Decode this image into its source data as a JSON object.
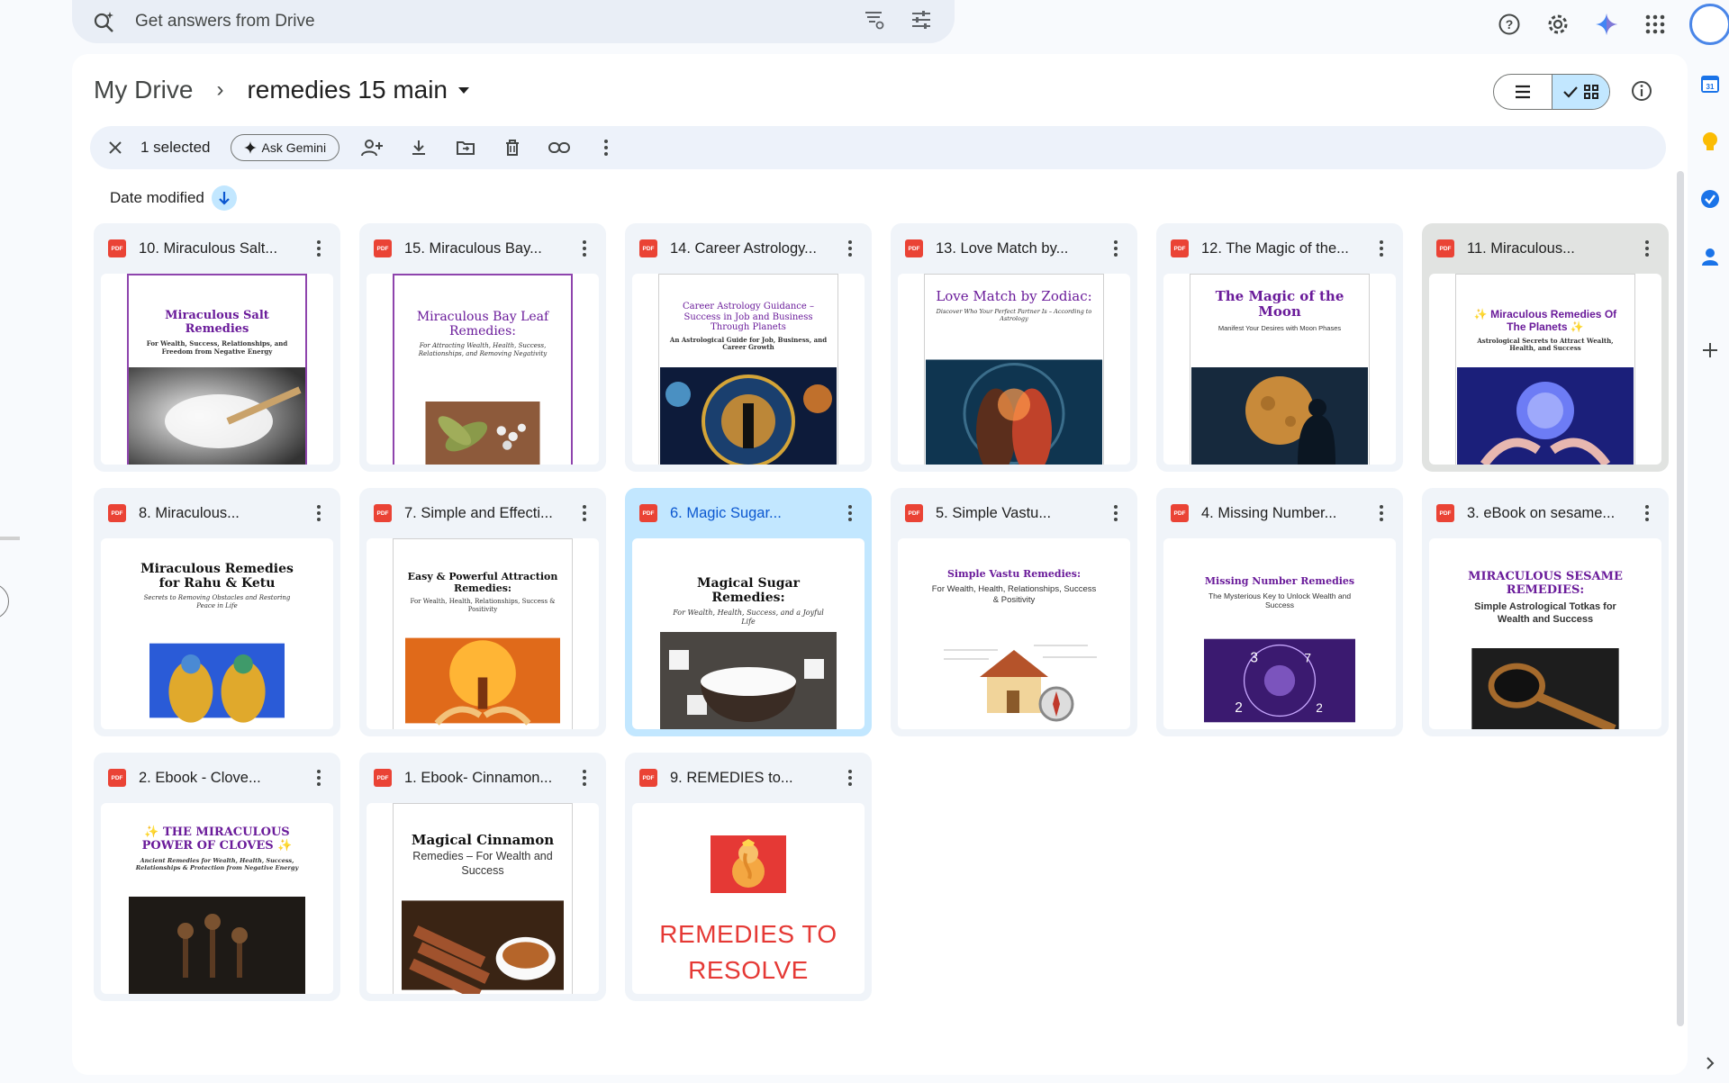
{
  "search": {
    "placeholder": "Get answers from Drive"
  },
  "breadcrumb": {
    "root": "My Drive",
    "current": "remedies 15 main"
  },
  "selection": {
    "count_label": "1 selected",
    "ask_gemini": "Ask Gemini"
  },
  "sort": {
    "label": "Date modified"
  },
  "files": [
    {
      "name": "10. Miraculous Salt...",
      "type": "PDF",
      "cover_title": "Miraculous Salt Remedies",
      "cover_sub": "For Wealth, Success, Relationships, and Freedom from Negative Energy"
    },
    {
      "name": "15. Miraculous Bay...",
      "type": "PDF",
      "cover_title": "Miraculous Bay Leaf Remedies:",
      "cover_sub": "For Attracting Wealth, Health, Success, Relationships, and Removing Negativity"
    },
    {
      "name": "14. Career Astrology...",
      "type": "PDF",
      "cover_title": "Career Astrology Guidance – Success in Job and Business Through Planets",
      "cover_sub": "An Astrological Guide for Job, Business, and Career Growth"
    },
    {
      "name": "13. Love Match by...",
      "type": "PDF",
      "cover_title": "Love Match by Zodiac:",
      "cover_sub": "Discover Who Your Perfect Partner Is – According to Astrology"
    },
    {
      "name": "12. The Magic of the...",
      "type": "PDF",
      "cover_title": "The Magic of the Moon",
      "cover_sub": "Manifest Your Desires with Moon Phases"
    },
    {
      "name": "11. Miraculous...",
      "type": "PDF",
      "cover_title": "✨ Miraculous Remedies Of The Planets ✨",
      "cover_sub": "Astrological Secrets to Attract Wealth, Health, and Success"
    },
    {
      "name": "8. Miraculous...",
      "type": "PDF",
      "cover_title": "Miraculous Remedies for Rahu & Ketu",
      "cover_sub": "Secrets to Removing Obstacles and Restoring Peace in Life"
    },
    {
      "name": "7. Simple and Effecti...",
      "type": "PDF",
      "cover_title": "Easy & Powerful Attraction Remedies:",
      "cover_sub": "For Wealth, Health, Relationships, Success & Positivity"
    },
    {
      "name": "6. Magic Sugar...",
      "type": "PDF",
      "cover_title": "Magical Sugar Remedies:",
      "cover_sub": "For Wealth, Health, Success, and a Joyful Life"
    },
    {
      "name": "5. Simple Vastu...",
      "type": "PDF",
      "cover_title": "Simple Vastu Remedies:",
      "cover_sub": "For Wealth, Health, Relationships, Success & Positivity"
    },
    {
      "name": "4. Missing Number...",
      "type": "PDF",
      "cover_title": "Missing Number Remedies",
      "cover_sub": "The Mysterious Key to Unlock Wealth and Success"
    },
    {
      "name": "3. eBook on sesame...",
      "type": "PDF",
      "cover_title": "MIRACULOUS SESAME REMEDIES:",
      "cover_sub": "Simple Astrological Totkas for Wealth and Success"
    },
    {
      "name": "2. Ebook - Clove...",
      "type": "PDF",
      "cover_title": "✨ THE MIRACULOUS POWER OF CLOVES ✨",
      "cover_sub": "Ancient Remedies for Wealth, Health, Success, Relationships & Protection from Negative Energy"
    },
    {
      "name": "1. Ebook- Cinnamon...",
      "type": "PDF",
      "cover_title": "Magical Cinnamon",
      "cover_sub": "Remedies – For Wealth and Success"
    },
    {
      "name": "9. REMEDIES to...",
      "type": "PDF",
      "cover_big_line1": "REMEDIES TO",
      "cover_big_line2": "RESOLVE"
    }
  ],
  "colors": {
    "accent": "#0b57d0",
    "selected_bg": "#c2e7ff",
    "pdf_red": "#ea4335"
  }
}
